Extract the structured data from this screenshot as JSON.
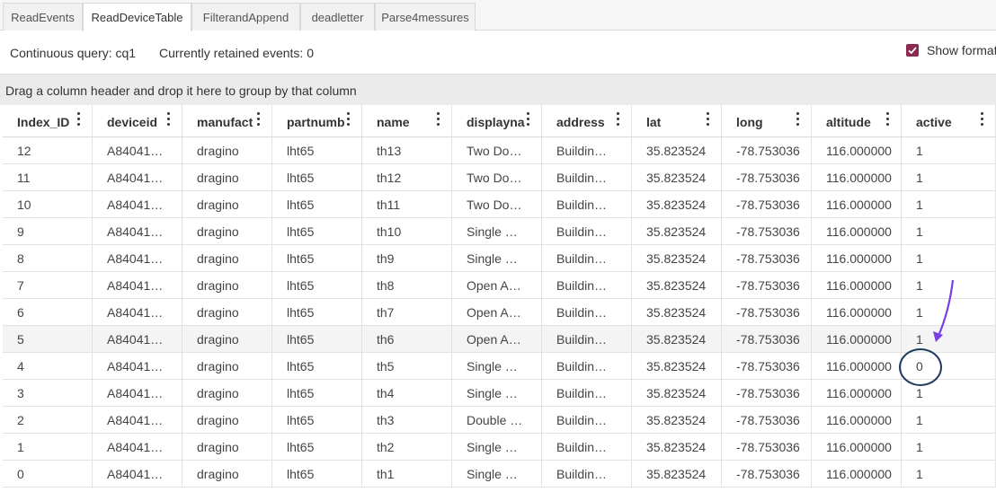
{
  "tabs": [
    {
      "label": "ReadEvents",
      "active": false
    },
    {
      "label": "ReadDeviceTable",
      "active": true
    },
    {
      "label": "FilterandAppend",
      "active": false
    },
    {
      "label": "deadletter",
      "active": false
    },
    {
      "label": "Parse4messures",
      "active": false
    }
  ],
  "info": {
    "continuous_query": "Continuous query: cq1",
    "retained_events": "Currently retained events: 0",
    "show_formatted_label": "Show formatted",
    "show_formatted_checked": true
  },
  "group_bar_text": "Drag a column header and drop it here to group by that column",
  "columns": [
    "Index_ID",
    "deviceid",
    "manufact",
    "partnumb",
    "name",
    "displayna",
    "address",
    "lat",
    "long",
    "altitude",
    "active"
  ],
  "rows": [
    [
      "12",
      "A84041…",
      "dragino",
      "lht65",
      "th13",
      "Two Do…",
      "Buildin…",
      "35.823524",
      "-78.753036",
      "116.000000",
      "1"
    ],
    [
      "11",
      "A84041…",
      "dragino",
      "lht65",
      "th12",
      "Two Do…",
      "Buildin…",
      "35.823524",
      "-78.753036",
      "116.000000",
      "1"
    ],
    [
      "10",
      "A84041…",
      "dragino",
      "lht65",
      "th11",
      "Two Do…",
      "Buildin…",
      "35.823524",
      "-78.753036",
      "116.000000",
      "1"
    ],
    [
      "9",
      "A84041…",
      "dragino",
      "lht65",
      "th10",
      "Single …",
      "Buildin…",
      "35.823524",
      "-78.753036",
      "116.000000",
      "1"
    ],
    [
      "8",
      "A84041…",
      "dragino",
      "lht65",
      "th9",
      "Single …",
      "Buildin…",
      "35.823524",
      "-78.753036",
      "116.000000",
      "1"
    ],
    [
      "7",
      "A84041…",
      "dragino",
      "lht65",
      "th8",
      "Open A…",
      "Buildin…",
      "35.823524",
      "-78.753036",
      "116.000000",
      "1"
    ],
    [
      "6",
      "A84041…",
      "dragino",
      "lht65",
      "th7",
      "Open A…",
      "Buildin…",
      "35.823524",
      "-78.753036",
      "116.000000",
      "1"
    ],
    [
      "5",
      "A84041…",
      "dragino",
      "lht65",
      "th6",
      "Open A…",
      "Buildin…",
      "35.823524",
      "-78.753036",
      "116.000000",
      "1"
    ],
    [
      "4",
      "A84041…",
      "dragino",
      "lht65",
      "th5",
      "Single …",
      "Buildin…",
      "35.823524",
      "-78.753036",
      "116.000000",
      "0"
    ],
    [
      "3",
      "A84041…",
      "dragino",
      "lht65",
      "th4",
      "Single …",
      "Buildin…",
      "35.823524",
      "-78.753036",
      "116.000000",
      "1"
    ],
    [
      "2",
      "A84041…",
      "dragino",
      "lht65",
      "th3",
      "Double …",
      "Buildin…",
      "35.823524",
      "-78.753036",
      "116.000000",
      "1"
    ],
    [
      "1",
      "A84041…",
      "dragino",
      "lht65",
      "th2",
      "Single …",
      "Buildin…",
      "35.823524",
      "-78.753036",
      "116.000000",
      "1"
    ],
    [
      "0",
      "A84041…",
      "dragino",
      "lht65",
      "th1",
      "Single …",
      "Buildin…",
      "35.823524",
      "-78.753036",
      "116.000000",
      "1"
    ]
  ],
  "colors": {
    "checkbox": "#8a2a4f",
    "annotation_arrow": "#7b3fe4",
    "annotation_circle": "#1f3d60"
  },
  "icons": {
    "column_menu": "vertical-ellipsis-icon",
    "checkbox": "checkmark-icon",
    "annotation": "arrow-icon"
  }
}
